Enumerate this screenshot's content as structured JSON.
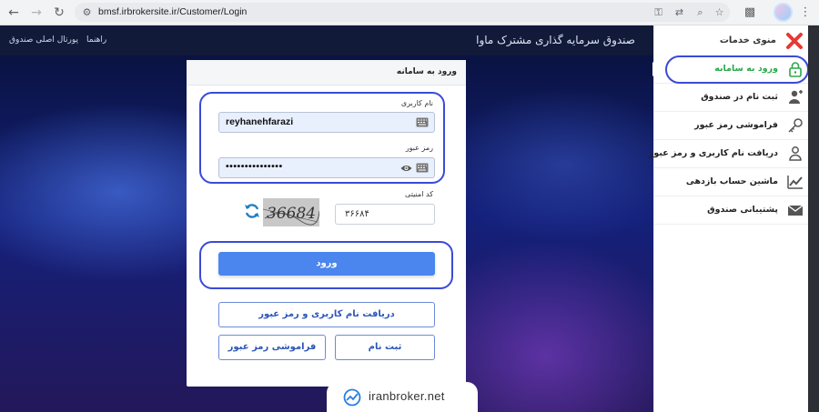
{
  "browser": {
    "url": "bmsf.irbrokersite.ir/Customer/Login"
  },
  "header": {
    "title": "صندوق سرمایه گذاری مشترک ماوا",
    "links": [
      "راهنما",
      "پورتال اصلی صندوق"
    ]
  },
  "sidebar": {
    "title": "منوی خدمات",
    "items": [
      {
        "label": "ورود به سامانه",
        "icon": "lock-icon",
        "active": true
      },
      {
        "label": "ثبت نام در صندوق",
        "icon": "user-plus-icon"
      },
      {
        "label": "فراموشی رمز عبور",
        "icon": "key-icon"
      },
      {
        "label": "دریافت نام کاربری و رمز عبور",
        "icon": "user-lock-icon"
      },
      {
        "label": "ماشین حساب بازدهی",
        "icon": "chart-line-icon"
      },
      {
        "label": "پشتیبانی صندوق",
        "icon": "envelope-icon"
      }
    ]
  },
  "login": {
    "title": "ورود به سامانه",
    "username_label": "نام کاربری",
    "username_value": "reyhanehfarazi",
    "password_label": "رمز عبور",
    "password_value": "•••••••••••••••",
    "captcha_label": "کد امنیتی",
    "captcha_image_text": "36684",
    "captcha_value": "۳۶۶۸۴",
    "submit_label": "ورود",
    "get_credentials_label": "دریافت نام کاربری و رمز عبور",
    "signup_label": "ثبت نام",
    "forgot_label": "فراموشی رمز عبور"
  },
  "watermark": {
    "text": "iranbroker.net"
  },
  "colors": {
    "accent": "#4a86ee",
    "active": "#2ba74a",
    "highlight_ring": "#3a4bd6"
  }
}
